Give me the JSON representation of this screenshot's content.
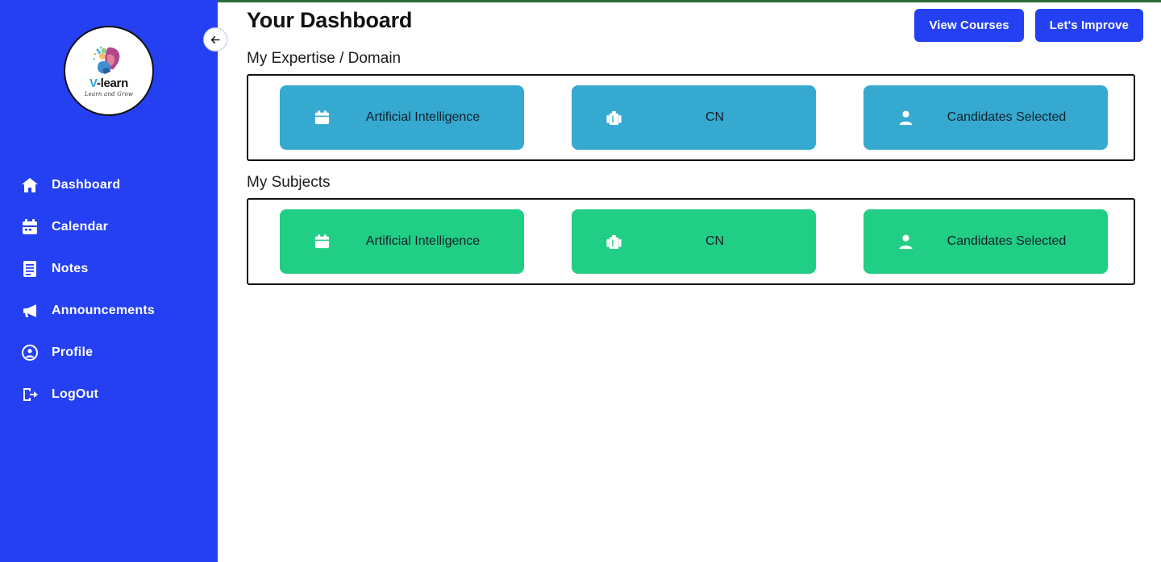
{
  "colors": {
    "sidebar_blue": "#2440F2",
    "button_blue": "#2440F2",
    "card_blue": "#35A9D0",
    "card_green": "#21CE85",
    "top_strip_green": "#2c6b37"
  },
  "sidebar": {
    "logo": {
      "name": "V-learn",
      "name_prefix": "V",
      "name_suffix": "-learn",
      "tagline": "Learn and Grow",
      "icon": "brain-head-logo"
    },
    "collapse_button": {
      "icon": "arrow-left-icon"
    },
    "items": [
      {
        "label": "Dashboard",
        "icon": "home-icon"
      },
      {
        "label": "Calendar",
        "icon": "calendar-icon"
      },
      {
        "label": "Notes",
        "icon": "notes-icon"
      },
      {
        "label": "Announcements",
        "icon": "megaphone-icon"
      },
      {
        "label": "Profile",
        "icon": "user-circle-icon"
      },
      {
        "label": "LogOut",
        "icon": "logout-icon"
      }
    ]
  },
  "header": {
    "title": "Your Dashboard",
    "actions": [
      {
        "label": "View Courses"
      },
      {
        "label": "Let's Improve"
      }
    ]
  },
  "sections": [
    {
      "title": "My Expertise / Domain",
      "variant": "blue",
      "cards": [
        {
          "label": "Artificial Intelligence",
          "icon": "calendar-icon"
        },
        {
          "label": "CN",
          "icon": "briefcase-icon"
        },
        {
          "label": "Candidates Selected",
          "icon": "person-icon"
        }
      ]
    },
    {
      "title": "My Subjects",
      "variant": "green",
      "cards": [
        {
          "label": "Artificial Intelligence",
          "icon": "calendar-icon"
        },
        {
          "label": "CN",
          "icon": "briefcase-icon"
        },
        {
          "label": "Candidates Selected",
          "icon": "person-icon"
        }
      ]
    }
  ]
}
